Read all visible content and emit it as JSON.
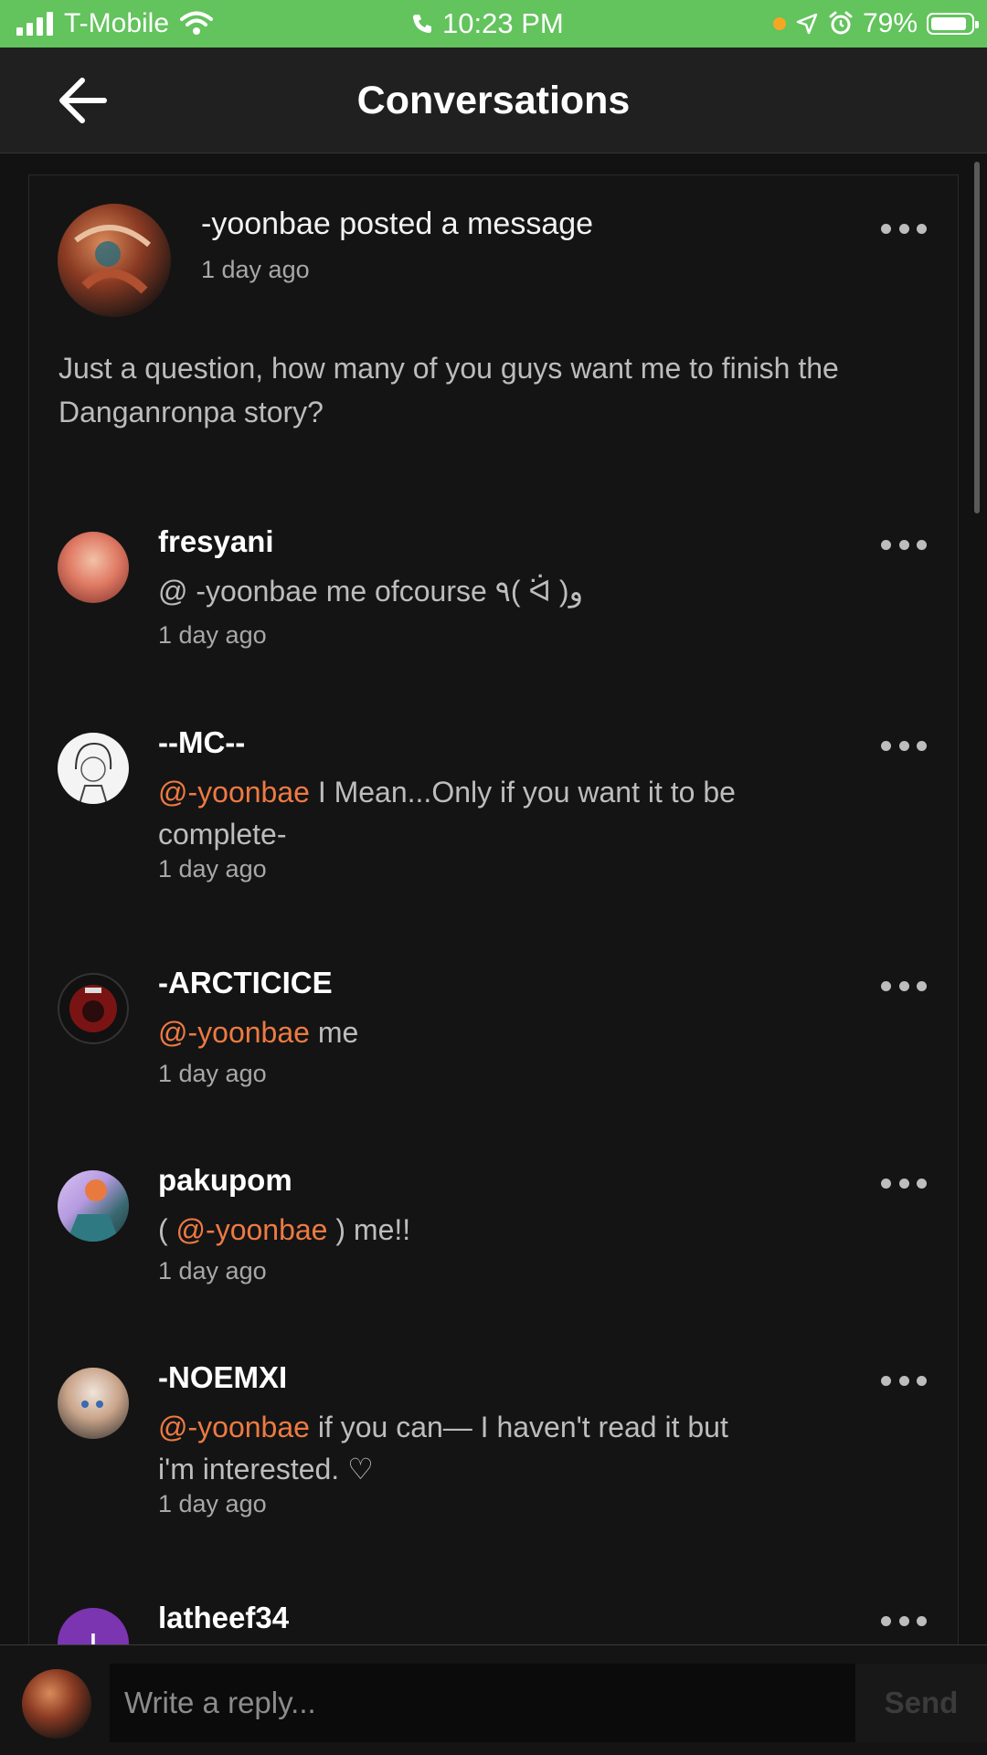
{
  "status_bar": {
    "carrier": "T-Mobile",
    "time": "10:23 PM",
    "battery": "79%",
    "battery_level": 0.79
  },
  "header": {
    "title": "Conversations",
    "back_icon": "arrow-left-icon"
  },
  "post": {
    "title": "-yoonbae posted a message",
    "time": "1 day ago",
    "body": "Just a question, how many of you guys want me to finish the Danganronpa story?"
  },
  "comments": [
    {
      "user": "fresyani",
      "prefix": "@ -yoonbae  me ofcourse ٩( ᐛ )و",
      "mention": "",
      "text": "",
      "time": "1 day ago"
    },
    {
      "user": "--MC--",
      "prefix": "",
      "mention": "@-yoonbae",
      "text": " I Mean...Only if you want it to be complete-",
      "time": "1 day ago"
    },
    {
      "user": "-ARCTICICE",
      "prefix": "",
      "mention": "@-yoonbae",
      "text": " me",
      "time": "1 day ago"
    },
    {
      "user": "pakupom",
      "prefix": "( ",
      "mention": "@-yoonbae",
      "text": " ) me!!",
      "time": "1 day ago"
    },
    {
      "user": "-NOEMXI",
      "prefix": "",
      "mention": "@-yoonbae",
      "text": " if you can— I haven't read it but i'm interested. ♡",
      "time": "1 day ago"
    },
    {
      "user": "latheef34",
      "avatar_letter": "l"
    }
  ],
  "reply": {
    "placeholder": "Write a reply...",
    "send_label": "Send"
  },
  "colors": {
    "status_bar": "#63c35d",
    "mention": "#ee7a43",
    "background": "#121212"
  }
}
